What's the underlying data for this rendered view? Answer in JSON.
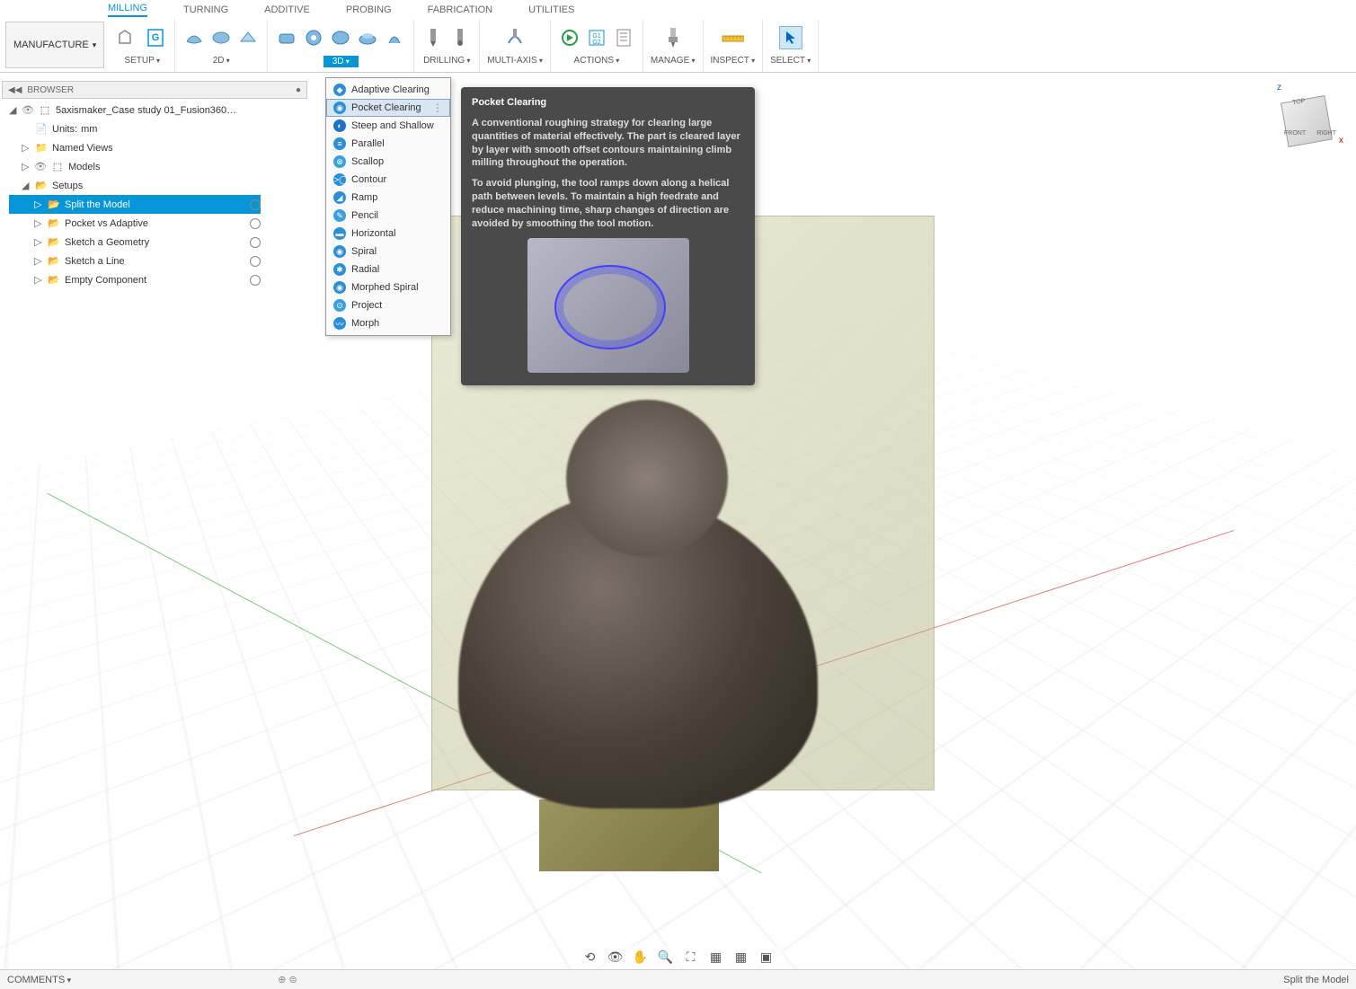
{
  "workspace": {
    "label": "MANUFACTURE"
  },
  "ribbon": {
    "tabs": [
      "MILLING",
      "TURNING",
      "ADDITIVE",
      "PROBING",
      "FABRICATION",
      "UTILITIES"
    ],
    "active_tab": "MILLING",
    "groups": {
      "setup": "SETUP",
      "g2d": "2D",
      "g3d": "3D",
      "drilling": "DRILLING",
      "multiaxis": "MULTI-AXIS",
      "actions": "ACTIONS",
      "manage": "MANAGE",
      "inspect": "INSPECT",
      "select": "SELECT"
    }
  },
  "dropdown": {
    "items": [
      {
        "label": "Adaptive Clearing",
        "color": "#2a8fd8"
      },
      {
        "label": "Pocket Clearing",
        "color": "#2a8fd8",
        "hovered": true
      },
      {
        "label": "Steep and Shallow",
        "color": "#1e73c9"
      },
      {
        "label": "Parallel",
        "color": "#2a8fd8"
      },
      {
        "label": "Scallop",
        "color": "#3aa0e0"
      },
      {
        "label": "Contour",
        "color": "#2a8fd8"
      },
      {
        "label": "Ramp",
        "color": "#2a8fd8"
      },
      {
        "label": "Pencil",
        "color": "#3aa0e0"
      },
      {
        "label": "Horizontal",
        "color": "#2a8fd8"
      },
      {
        "label": "Spiral",
        "color": "#2a8fd8"
      },
      {
        "label": "Radial",
        "color": "#2a8fd8"
      },
      {
        "label": "Morphed Spiral",
        "color": "#2a8fd8"
      },
      {
        "label": "Project",
        "color": "#3aa0e0"
      },
      {
        "label": "Morph",
        "color": "#2a8fd8"
      }
    ]
  },
  "tooltip": {
    "title": "Pocket Clearing",
    "para1": "A conventional roughing strategy for clearing large quantities of material effectively. The part is cleared layer by layer with smooth offset contours maintaining climb milling throughout the operation.",
    "para2": "To avoid plunging, the tool ramps down along a helical path between levels. To maintain a high feedrate and reduce machining time, sharp changes of direction are avoided by smoothing the tool motion."
  },
  "browser": {
    "header": "BROWSER",
    "doc": "5axismaker_Case study 01_Fusion360…",
    "units_label": "Units:",
    "units_value": "mm",
    "named_views": "Named Views",
    "models": "Models",
    "setups": "Setups",
    "setup_items": [
      {
        "label": "Split the Model",
        "selected": true,
        "radio_on": true
      },
      {
        "label": "Pocket vs Adaptive"
      },
      {
        "label": "Sketch a Geometry"
      },
      {
        "label": "Sketch a Line"
      },
      {
        "label": "Empty Component"
      }
    ]
  },
  "viewcube": {
    "top": "TOP",
    "front": "FRONT",
    "right": "RIGHT",
    "z": "z",
    "x": "x"
  },
  "status": {
    "comments": "COMMENTS",
    "right": "Split the Model"
  }
}
